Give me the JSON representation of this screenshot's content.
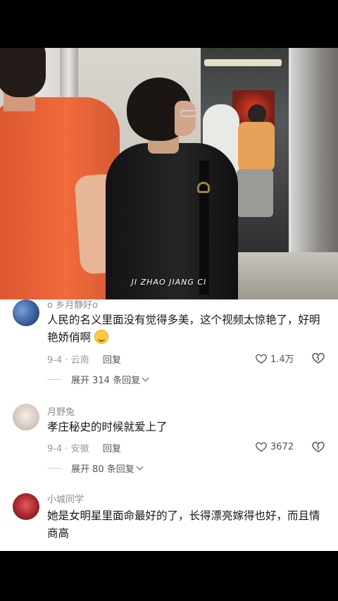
{
  "video": {
    "caption": "JI ZHAO JIANG CI"
  },
  "comments": [
    {
      "username": "o 乡月静好o",
      "text": "人民的名义里面没有觉得多美，这个视频太惊艳了，好明艳娇俏啊",
      "emoji": "grin-squint-emoji",
      "date_location": "9-4 · 云南",
      "reply_label": "回复",
      "likes": "1.4万",
      "expand_label": "展开 314 条回复"
    },
    {
      "username": "月野兔",
      "text": "孝庄秘史的时候就爱上了",
      "date_location": "9-4 · 安徽",
      "reply_label": "回复",
      "likes": "3672",
      "expand_label": "展开 80 条回复"
    },
    {
      "username": "小城同学",
      "text": "她是女明星里面命最好的了，长得漂亮嫁得也好，而且情商高",
      "date_location": "",
      "reply_label": "",
      "likes": ""
    }
  ],
  "colors": {
    "background": "#ffffff",
    "text": "#161616",
    "secondary": "#9a9a9a"
  }
}
